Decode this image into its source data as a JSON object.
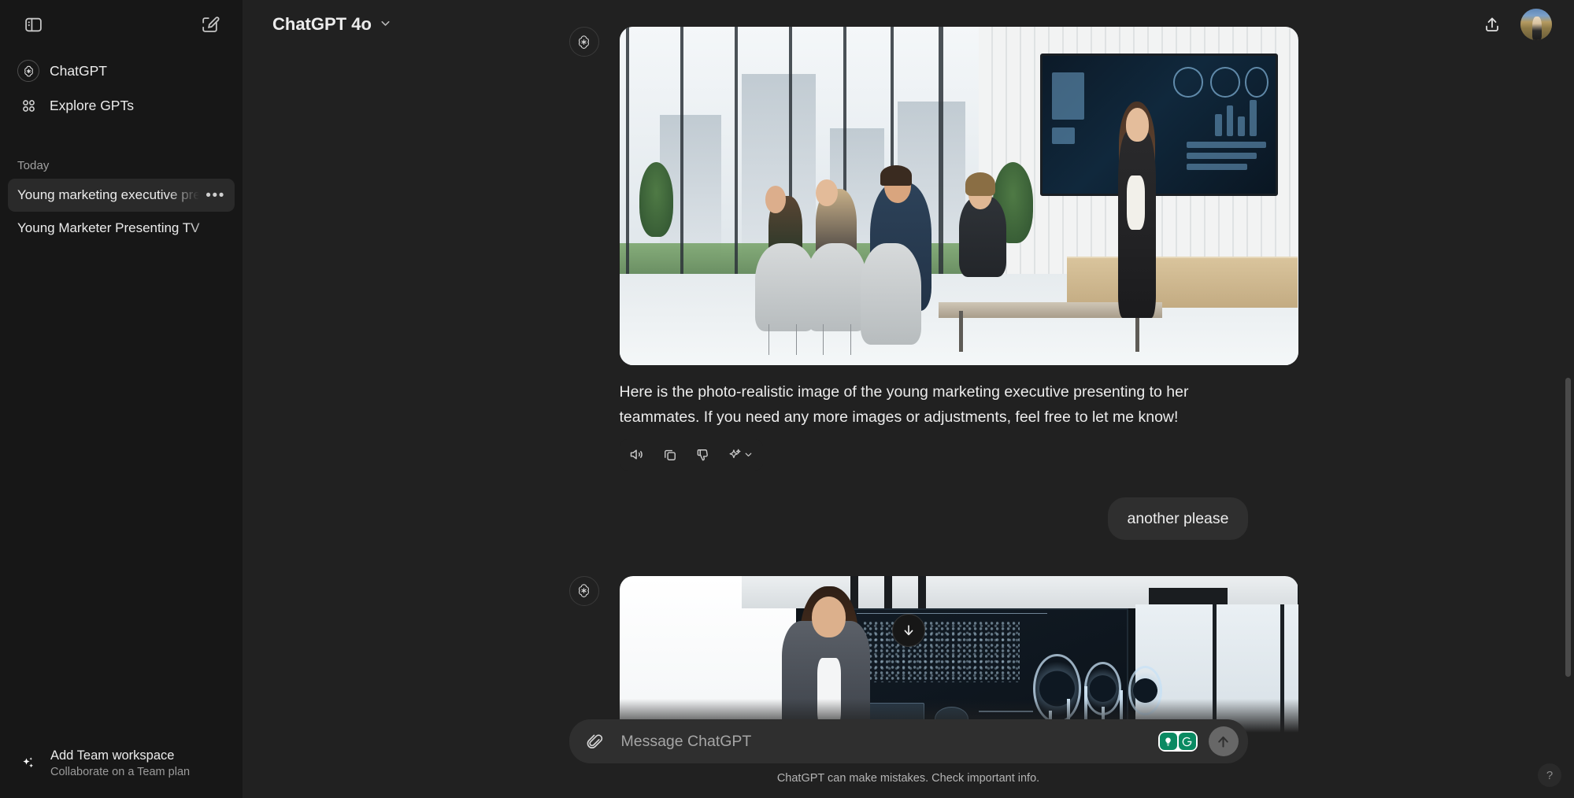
{
  "app": {
    "title": "ChatGPT"
  },
  "sidebar": {
    "toggle_icon": "sidebar-toggle-icon",
    "new_chat_icon": "new-chat-pencil-icon",
    "nav": [
      {
        "label": "ChatGPT",
        "icon": "openai-logo-icon"
      },
      {
        "label": "Explore GPTs",
        "icon": "grid-squares-icon"
      }
    ],
    "section_label": "Today",
    "chats": [
      {
        "title": "Young marketing executive pre",
        "active": true,
        "menu": "•••"
      },
      {
        "title": "Young Marketer Presenting TV",
        "active": false,
        "menu": ""
      }
    ],
    "team": {
      "icon": "sparkles-icon",
      "title": "Add Team workspace",
      "subtitle": "Collaborate on a Team plan"
    }
  },
  "header": {
    "model": "ChatGPT 4o",
    "chevron": "chevron-down-icon",
    "share_icon": "share-upload-icon",
    "avatar": "user-avatar"
  },
  "conversation": {
    "messages": [
      {
        "role": "assistant",
        "image_alt": "Photo-realistic conference room: young marketing executive presenting to teammates",
        "text": "Here is the photo-realistic image of the young marketing executive presenting to her teammates. If you need any more images or adjustments, feel free to let me know!",
        "actions": [
          {
            "name": "read-aloud-button",
            "icon": "speaker-icon"
          },
          {
            "name": "copy-button",
            "icon": "copy-icon"
          },
          {
            "name": "dislike-button",
            "icon": "thumbs-down-icon"
          },
          {
            "name": "model-switch-button",
            "icon": "sparkle-icon"
          }
        ]
      },
      {
        "role": "user",
        "text": "another please"
      },
      {
        "role": "assistant",
        "image_alt": "Woman in grey suit presenting a dark analytics dashboard with world map, gauges and bar charts"
      }
    ],
    "scroll_to_bottom_icon": "arrow-down-icon"
  },
  "composer": {
    "attach_icon": "paperclip-icon",
    "placeholder": "Message ChatGPT",
    "value": "",
    "extensions": [
      {
        "name": "grammarly-suggestion-icon",
        "glyph": "lightbulb-icon"
      },
      {
        "name": "grammarly-logo-icon",
        "glyph": "G"
      }
    ],
    "send_icon": "arrow-up-icon",
    "footer_note": "ChatGPT can make mistakes. Check important info.",
    "help_label": "?"
  },
  "colors": {
    "sidebar_bg": "#171717",
    "main_bg": "#212121",
    "bubble_bg": "#2f2f2f",
    "text": "#ececec",
    "muted": "#a0a0a0",
    "grammarly_green": "#0a8a62"
  }
}
